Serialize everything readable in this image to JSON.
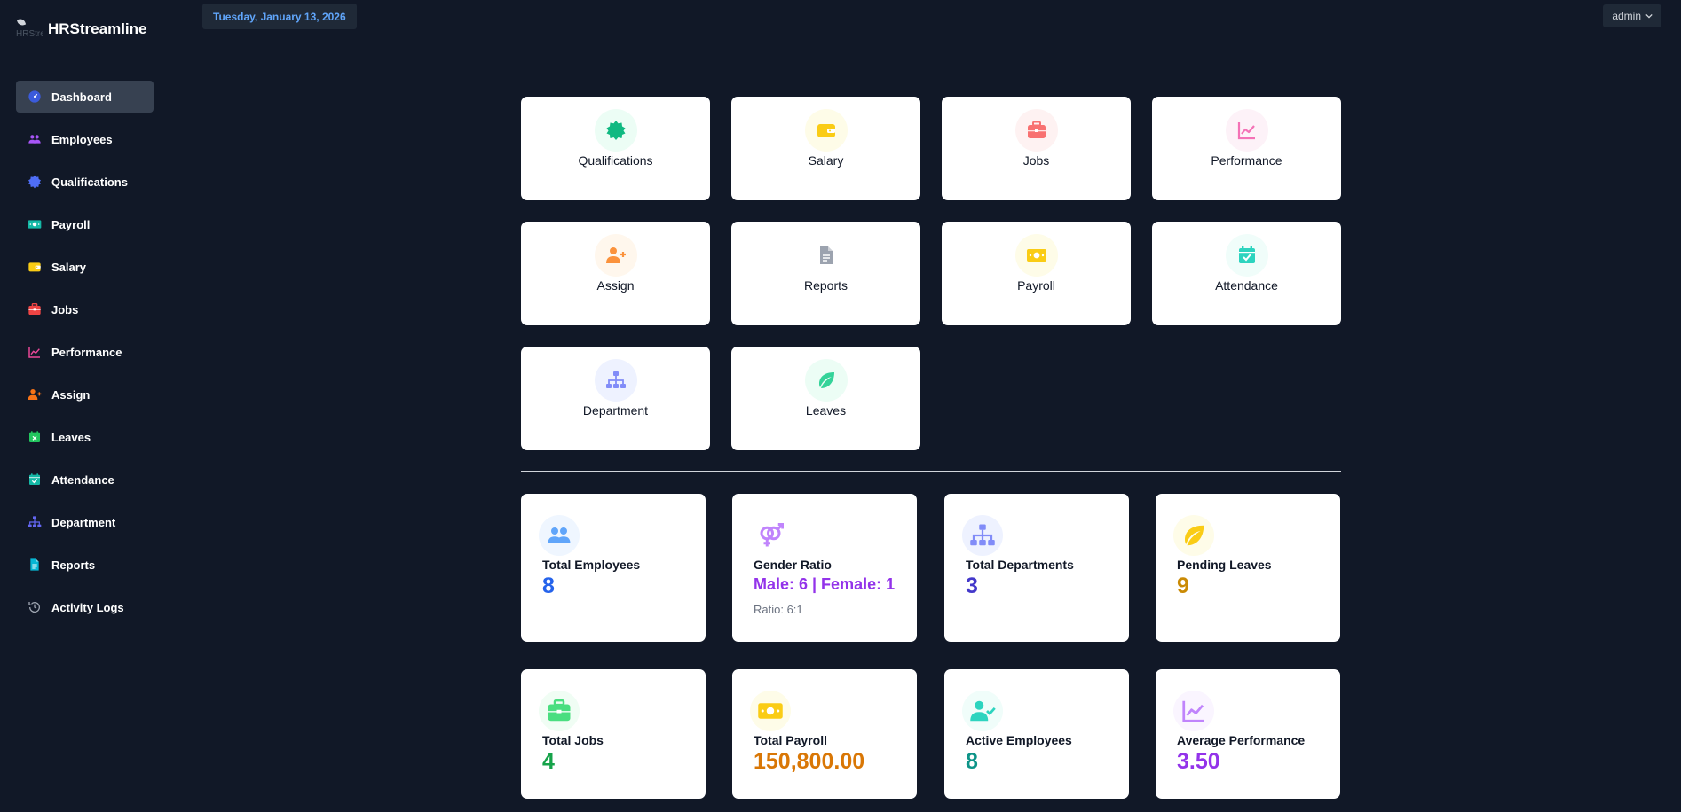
{
  "brand": {
    "name": "HRStreamline",
    "logo_alt": "HRStre"
  },
  "sidebar": {
    "items": [
      {
        "label": "Dashboard",
        "icon": "dashboard-icon",
        "color": "#3b5bdb"
      },
      {
        "label": "Employees",
        "icon": "users-icon",
        "color": "#a855f7"
      },
      {
        "label": "Qualifications",
        "icon": "certificate-icon",
        "color": "#4f6ef7"
      },
      {
        "label": "Payroll",
        "icon": "money-icon",
        "color": "#14b8a6"
      },
      {
        "label": "Salary",
        "icon": "wallet-icon",
        "color": "#facc15"
      },
      {
        "label": "Jobs",
        "icon": "briefcase-icon",
        "color": "#ef4444"
      },
      {
        "label": "Performance",
        "icon": "chart-line-icon",
        "color": "#ec4899"
      },
      {
        "label": "Assign",
        "icon": "user-plus-icon",
        "color": "#f97316"
      },
      {
        "label": "Leaves",
        "icon": "calendar-x-icon",
        "color": "#22c55e"
      },
      {
        "label": "Attendance",
        "icon": "calendar-check-icon",
        "color": "#14b8a6"
      },
      {
        "label": "Department",
        "icon": "sitemap-icon",
        "color": "#6366f1"
      },
      {
        "label": "Reports",
        "icon": "file-icon",
        "color": "#06b6d4"
      },
      {
        "label": "Activity Logs",
        "icon": "history-icon",
        "color": "#9ca3af"
      }
    ]
  },
  "topbar": {
    "date": "Tuesday, January 13, 2026",
    "user": "admin"
  },
  "tiles": [
    {
      "label": "Qualifications",
      "icon": "certificate-icon",
      "color": "#10b981",
      "bg": "#ecfdf5"
    },
    {
      "label": "Salary",
      "icon": "wallet-icon",
      "color": "#facc15",
      "bg": "#fefce8"
    },
    {
      "label": "Jobs",
      "icon": "briefcase-icon",
      "color": "#f87171",
      "bg": "#fef2f2"
    },
    {
      "label": "Performance",
      "icon": "chart-line-icon",
      "color": "#f472b6",
      "bg": "#fdf2f8"
    },
    {
      "label": "Assign",
      "icon": "user-plus-icon",
      "color": "#fb923c",
      "bg": "#fff7ed"
    },
    {
      "label": "Reports",
      "icon": "file-icon",
      "color": "#9ca3af",
      "bg": "#ffffff"
    },
    {
      "label": "Payroll",
      "icon": "money-icon",
      "color": "#facc15",
      "bg": "#fefce8"
    },
    {
      "label": "Attendance",
      "icon": "calendar-check-icon",
      "color": "#2dd4bf",
      "bg": "#f0fdfa"
    },
    {
      "label": "Department",
      "icon": "sitemap-icon",
      "color": "#818cf8",
      "bg": "#eef2ff"
    },
    {
      "label": "Leaves",
      "icon": "leaf-icon",
      "color": "#34d399",
      "bg": "#ecfdf5"
    }
  ],
  "stats": [
    {
      "label": "Total Employees",
      "value": "8",
      "color": "#2563eb",
      "icon": "users-icon",
      "icon_color": "#60a5fa",
      "bg": "#eff6ff"
    },
    {
      "label": "Gender Ratio",
      "value": "Male: 6 | Female: 1",
      "sub": "Ratio: 6:1",
      "color": "#9333ea",
      "icon": "gender-icon",
      "icon_color": "#c084fc",
      "bg": "#ffffff"
    },
    {
      "label": "Total Departments",
      "value": "3",
      "color": "#4338ca",
      "icon": "sitemap-icon",
      "icon_color": "#818cf8",
      "bg": "#eef2ff"
    },
    {
      "label": "Pending Leaves",
      "value": "9",
      "color": "#ca8a04",
      "icon": "leaf-icon",
      "icon_color": "#facc15",
      "bg": "#fefce8"
    },
    {
      "label": "Total Jobs",
      "value": "4",
      "color": "#16a34a",
      "icon": "briefcase-icon",
      "icon_color": "#4ade80",
      "bg": "#f0fdf4"
    },
    {
      "label": "Total Payroll",
      "value": "150,800.00",
      "color": "#d97706",
      "icon": "money-icon",
      "icon_color": "#facc15",
      "bg": "#fefce8"
    },
    {
      "label": "Active Employees",
      "value": "8",
      "color": "#0d9488",
      "icon": "user-check-icon",
      "icon_color": "#2dd4bf",
      "bg": "#f0fdfa"
    },
    {
      "label": "Average Performance",
      "value": "3.50",
      "color": "#9333ea",
      "icon": "chart-line-icon",
      "icon_color": "#c084fc",
      "bg": "#faf5ff"
    }
  ]
}
